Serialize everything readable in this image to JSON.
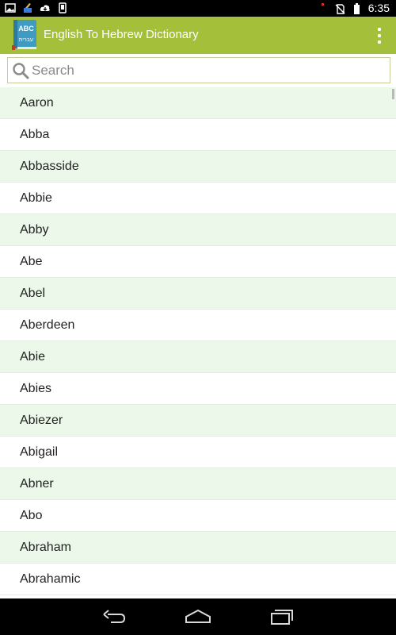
{
  "status_bar": {
    "time": "6:35",
    "left_icons": [
      "gallery-icon",
      "cleaner-icon",
      "cloud-download-icon",
      "phone-icon"
    ],
    "right_icons": [
      "notification-dot-icon",
      "no-sim-icon",
      "battery-icon"
    ]
  },
  "app_bar": {
    "logo_text_top": "ABC",
    "logo_text_bottom": "עברית",
    "title": "English To Hebrew Dictionary",
    "overflow_icon": "overflow-menu-icon",
    "color": "#a4c03a"
  },
  "search": {
    "placeholder": "Search",
    "value": ""
  },
  "words": [
    "Aaron",
    "Abba",
    "Abbasside",
    "Abbie",
    "Abby",
    "Abe",
    "Abel",
    "Aberdeen",
    "Abie",
    "Abies",
    "Abiezer",
    "Abigail",
    "Abner",
    "Abo",
    "Abraham",
    "Abrahamic"
  ],
  "nav_bar": {
    "buttons": [
      "back-icon",
      "home-icon",
      "recents-icon"
    ]
  },
  "colors": {
    "alt_row": "#ecf8ea",
    "app_bar": "#a4c03a"
  }
}
